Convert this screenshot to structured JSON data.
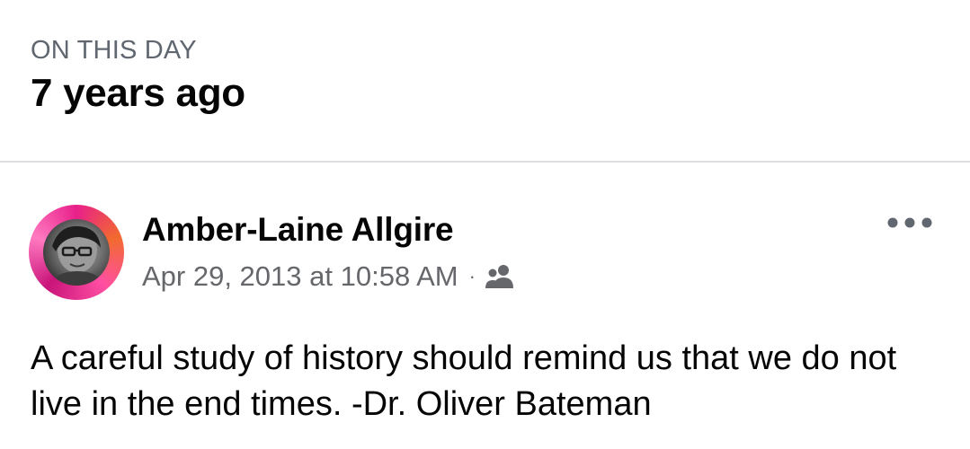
{
  "memory": {
    "section_label": "ON THIS DAY",
    "years_ago": "7 years ago"
  },
  "post": {
    "author": "Amber-Laine Allgire",
    "timestamp": "Apr 29, 2013 at 10:58 AM",
    "separator": "·",
    "audience_icon": "friends-icon",
    "more_icon": "more-options-icon",
    "text": "A careful study of history should remind us that we do not live in the end times. -Dr. Oliver Bateman"
  },
  "colors": {
    "primary_text": "#050505",
    "secondary_text": "#65676b",
    "header_label": "#606770",
    "divider": "#dcdee2",
    "avatar_ring": "#e8208a"
  }
}
